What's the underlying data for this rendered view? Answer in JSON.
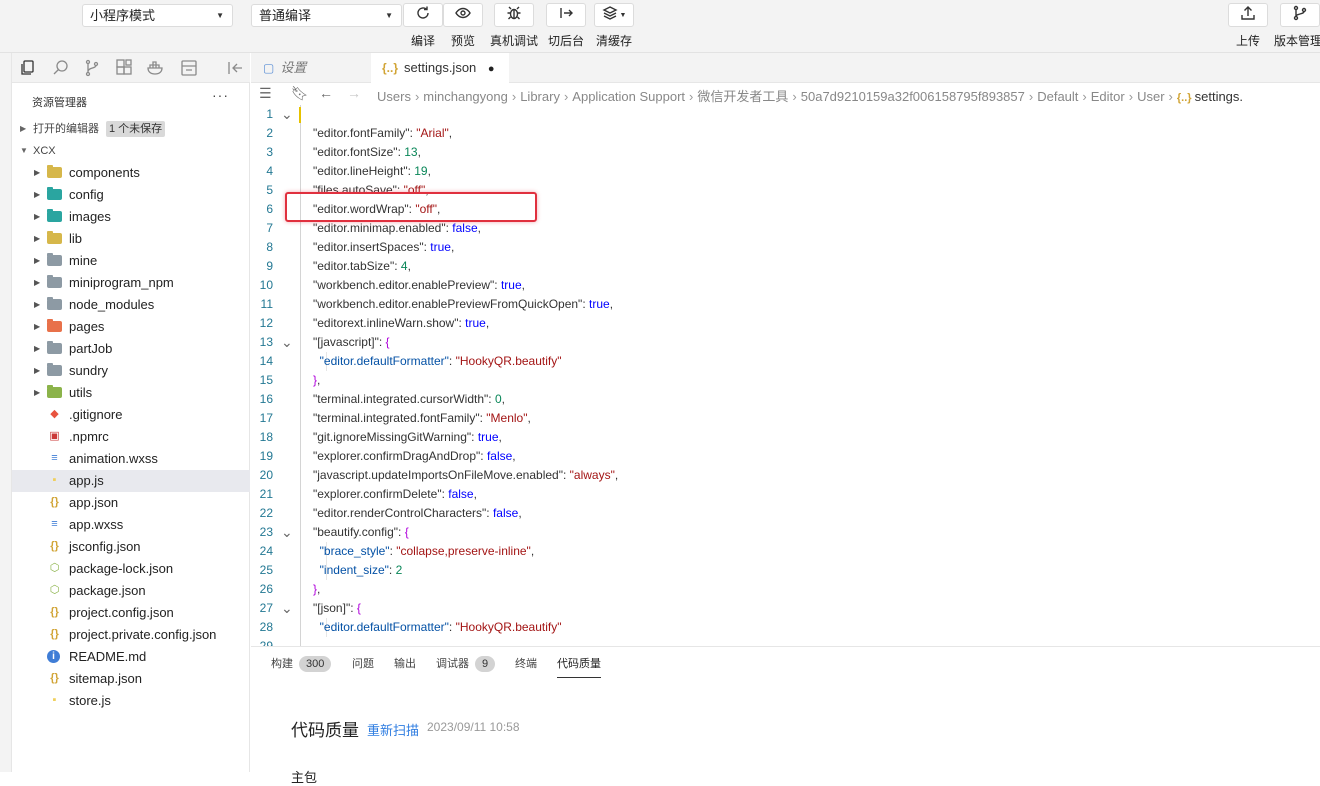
{
  "toolbar": {
    "mode_select": "小程序模式",
    "compile_select": "普通编译",
    "buttons": [
      {
        "label": "编译",
        "icon": "refresh-icon"
      },
      {
        "label": "预览",
        "icon": "eye-icon"
      },
      {
        "label": "真机调试",
        "icon": "bug-icon"
      },
      {
        "label": "切后台",
        "icon": "switch-background-icon"
      },
      {
        "label": "清缓存",
        "icon": "layers-icon"
      }
    ],
    "right_buttons": [
      {
        "label": "上传",
        "icon": "upload-icon"
      },
      {
        "label": "版本管理",
        "icon": "branch-icon"
      }
    ]
  },
  "explorer": {
    "title": "资源管理器",
    "more": "···",
    "open_editors": "打开的编辑器",
    "unsaved_badge": "1 个未保存",
    "project": "XCX",
    "items": [
      {
        "name": "components",
        "type": "folder",
        "color": "yellow"
      },
      {
        "name": "config",
        "type": "folder",
        "color": "teal"
      },
      {
        "name": "images",
        "type": "folder",
        "color": "teal"
      },
      {
        "name": "lib",
        "type": "folder",
        "color": "yellow"
      },
      {
        "name": "mine",
        "type": "folder",
        "color": "gray"
      },
      {
        "name": "miniprogram_npm",
        "type": "folder",
        "color": "gray"
      },
      {
        "name": "node_modules",
        "type": "folder",
        "color": "gray"
      },
      {
        "name": "pages",
        "type": "folder",
        "color": "orange"
      },
      {
        "name": "partJob",
        "type": "folder",
        "color": "gray"
      },
      {
        "name": "sundry",
        "type": "folder",
        "color": "gray"
      },
      {
        "name": "utils",
        "type": "folder",
        "color": "green"
      },
      {
        "name": ".gitignore",
        "type": "git"
      },
      {
        "name": ".npmrc",
        "type": "npm"
      },
      {
        "name": "animation.wxss",
        "type": "css"
      },
      {
        "name": "app.js",
        "type": "js",
        "selected": true
      },
      {
        "name": "app.json",
        "type": "json"
      },
      {
        "name": "app.wxss",
        "type": "css"
      },
      {
        "name": "jsconfig.json",
        "type": "json"
      },
      {
        "name": "package-lock.json",
        "type": "node"
      },
      {
        "name": "package.json",
        "type": "node"
      },
      {
        "name": "project.config.json",
        "type": "json"
      },
      {
        "name": "project.private.config.json",
        "type": "json"
      },
      {
        "name": "README.md",
        "type": "info"
      },
      {
        "name": "sitemap.json",
        "type": "json"
      },
      {
        "name": "store.js",
        "type": "js"
      }
    ]
  },
  "tabs": [
    {
      "label": "设置",
      "icon": "file-icon",
      "active": false
    },
    {
      "label": "settings.json",
      "icon": "json-icon",
      "active": true,
      "dirty": "●"
    }
  ],
  "breadcrumb": [
    "Users",
    "minchangyong",
    "Library",
    "Application Support",
    "微信开发者工具",
    "50a7d9210159a32f006158795f893857",
    "Default",
    "Editor",
    "User",
    "settings."
  ],
  "editor": {
    "lines": [
      {
        "n": "1",
        "fold": true,
        "tokens": []
      },
      {
        "n": "2",
        "tokens": [
          [
            "kk",
            "\"editor.fontFamily\""
          ],
          [
            "p",
            ": "
          ],
          [
            "strv",
            "\"Arial\""
          ],
          [
            "p",
            ","
          ]
        ]
      },
      {
        "n": "3",
        "tokens": [
          [
            "kk",
            "\"editor.fontSize\""
          ],
          [
            "p",
            ": "
          ],
          [
            "num",
            "13"
          ],
          [
            "p",
            ","
          ]
        ]
      },
      {
        "n": "4",
        "tokens": [
          [
            "kk",
            "\"editor.lineHeight\""
          ],
          [
            "p",
            ": "
          ],
          [
            "num",
            "19"
          ],
          [
            "p",
            ","
          ]
        ]
      },
      {
        "n": "5",
        "tokens": [
          [
            "kk",
            "\"files.autoSave\""
          ],
          [
            "p",
            ": "
          ],
          [
            "strv",
            "\"off\""
          ],
          [
            "p",
            ","
          ]
        ]
      },
      {
        "n": "6",
        "tokens": [
          [
            "kk",
            "\"editor.wordWrap\""
          ],
          [
            "p",
            ": "
          ],
          [
            "strv",
            "\"off\""
          ],
          [
            "p",
            ","
          ]
        ]
      },
      {
        "n": "7",
        "tokens": [
          [
            "kk",
            "\"editor.minimap.enabled\""
          ],
          [
            "p",
            ": "
          ],
          [
            "bool",
            "false"
          ],
          [
            "p",
            ","
          ]
        ]
      },
      {
        "n": "8",
        "tokens": [
          [
            "kk",
            "\"editor.insertSpaces\""
          ],
          [
            "p",
            ": "
          ],
          [
            "bool",
            "true"
          ],
          [
            "p",
            ","
          ]
        ]
      },
      {
        "n": "9",
        "tokens": [
          [
            "kk",
            "\"editor.tabSize\""
          ],
          [
            "p",
            ": "
          ],
          [
            "num",
            "4"
          ],
          [
            "p",
            ","
          ]
        ]
      },
      {
        "n": "10",
        "tokens": [
          [
            "kk",
            "\"workbench.editor.enablePreview\""
          ],
          [
            "p",
            ": "
          ],
          [
            "bool",
            "true"
          ],
          [
            "p",
            ","
          ]
        ]
      },
      {
        "n": "11",
        "tokens": [
          [
            "kk",
            "\"workbench.editor.enablePreviewFromQuickOpen\""
          ],
          [
            "p",
            ": "
          ],
          [
            "bool",
            "true"
          ],
          [
            "p",
            ","
          ]
        ]
      },
      {
        "n": "12",
        "tokens": [
          [
            "kk",
            "\"editorext.inlineWarn.show\""
          ],
          [
            "p",
            ": "
          ],
          [
            "bool",
            "true"
          ],
          [
            "p",
            ","
          ]
        ]
      },
      {
        "n": "13",
        "fold": true,
        "tokens": [
          [
            "kk",
            "\"[javascript]\""
          ],
          [
            "p",
            ": "
          ],
          [
            "brace",
            "{"
          ]
        ]
      },
      {
        "n": "14",
        "tokens": [
          [
            "p",
            "  "
          ],
          [
            "nested-key",
            "\"editor.defaultFormatter\""
          ],
          [
            "p",
            ": "
          ],
          [
            "strv",
            "\"HookyQR.beautify\""
          ]
        ]
      },
      {
        "n": "15",
        "tokens": [
          [
            "brace",
            "}"
          ],
          [
            "p",
            ","
          ]
        ]
      },
      {
        "n": "16",
        "tokens": [
          [
            "kk",
            "\"terminal.integrated.cursorWidth\""
          ],
          [
            "p",
            ": "
          ],
          [
            "num",
            "0"
          ],
          [
            "p",
            ","
          ]
        ]
      },
      {
        "n": "17",
        "tokens": [
          [
            "kk",
            "\"terminal.integrated.fontFamily\""
          ],
          [
            "p",
            ": "
          ],
          [
            "strv",
            "\"Menlo\""
          ],
          [
            "p",
            ","
          ]
        ]
      },
      {
        "n": "18",
        "tokens": [
          [
            "kk",
            "\"git.ignoreMissingGitWarning\""
          ],
          [
            "p",
            ": "
          ],
          [
            "bool",
            "true"
          ],
          [
            "p",
            ","
          ]
        ]
      },
      {
        "n": "19",
        "tokens": [
          [
            "kk",
            "\"explorer.confirmDragAndDrop\""
          ],
          [
            "p",
            ": "
          ],
          [
            "bool",
            "false"
          ],
          [
            "p",
            ","
          ]
        ]
      },
      {
        "n": "20",
        "tokens": [
          [
            "kk",
            "\"javascript.updateImportsOnFileMove.enabled\""
          ],
          [
            "p",
            ": "
          ],
          [
            "strv",
            "\"always\""
          ],
          [
            "p",
            ","
          ]
        ]
      },
      {
        "n": "21",
        "tokens": [
          [
            "kk",
            "\"explorer.confirmDelete\""
          ],
          [
            "p",
            ": "
          ],
          [
            "bool",
            "false"
          ],
          [
            "p",
            ","
          ]
        ]
      },
      {
        "n": "22",
        "tokens": [
          [
            "kk",
            "\"editor.renderControlCharacters\""
          ],
          [
            "p",
            ": "
          ],
          [
            "bool",
            "false"
          ],
          [
            "p",
            ","
          ]
        ]
      },
      {
        "n": "23",
        "fold": true,
        "tokens": [
          [
            "kk",
            "\"beautify.config\""
          ],
          [
            "p",
            ": "
          ],
          [
            "brace",
            "{"
          ]
        ]
      },
      {
        "n": "24",
        "tokens": [
          [
            "p",
            "  "
          ],
          [
            "nested-key",
            "\"brace_style\""
          ],
          [
            "p",
            ": "
          ],
          [
            "strv",
            "\"collapse,preserve-inline\""
          ],
          [
            "p",
            ","
          ]
        ]
      },
      {
        "n": "25",
        "tokens": [
          [
            "p",
            "  "
          ],
          [
            "nested-key",
            "\"indent_size\""
          ],
          [
            "p",
            ": "
          ],
          [
            "num",
            "2"
          ]
        ]
      },
      {
        "n": "26",
        "tokens": [
          [
            "brace",
            "}"
          ],
          [
            "p",
            ","
          ]
        ]
      },
      {
        "n": "27",
        "fold": true,
        "tokens": [
          [
            "kk",
            "\"[json]\""
          ],
          [
            "p",
            ": "
          ],
          [
            "brace",
            "{"
          ]
        ]
      },
      {
        "n": "28",
        "tokens": [
          [
            "p",
            "  "
          ],
          [
            "nested-key",
            "\"editor.defaultFormatter\""
          ],
          [
            "p",
            ": "
          ],
          [
            "strv",
            "\"HookyQR.beautify\""
          ]
        ]
      },
      {
        "n": "29",
        "tokens": []
      }
    ]
  },
  "panel": {
    "tabs": [
      {
        "label": "构建",
        "badge": "300"
      },
      {
        "label": "问题"
      },
      {
        "label": "输出"
      },
      {
        "label": "调试器",
        "badge": "9"
      },
      {
        "label": "终端"
      },
      {
        "label": "代码质量",
        "active": true
      }
    ],
    "quality_title": "代码质量",
    "rescan": "重新扫描",
    "timestamp": "2023/09/11 10:58",
    "sub_heading": "主包"
  },
  "colors": {
    "highlight_border": "#e0303e",
    "key": "#333333",
    "string": "#a31515",
    "number": "#098658",
    "boolean": "#0000ff",
    "brace": "#af00db",
    "link": "#2f7de1"
  }
}
